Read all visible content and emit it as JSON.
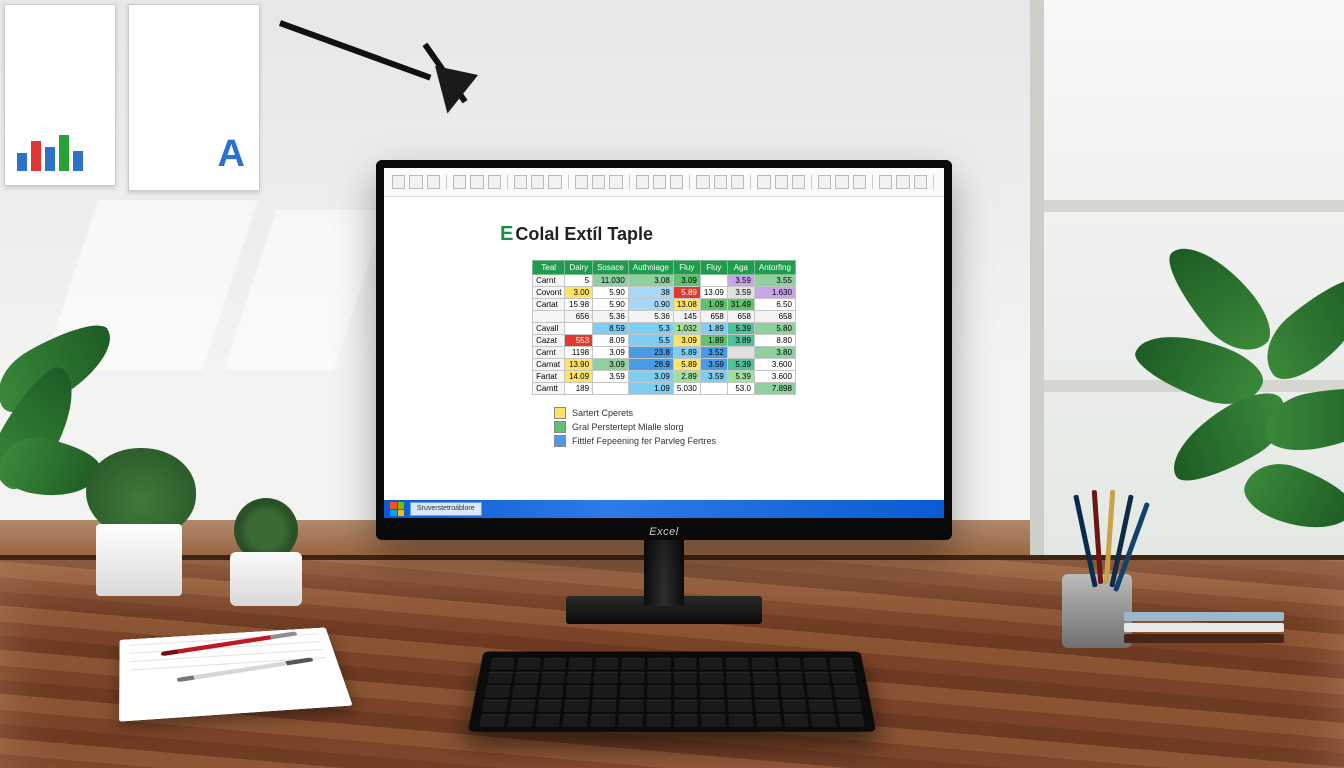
{
  "monitor_brand": "Excel",
  "screen": {
    "title_prefix": "E",
    "title_rest": "Colal Extíl Taple",
    "toolbar_groups": 9,
    "table": {
      "headers": [
        "Teal",
        "Dairy",
        "Sosace",
        "Authniage",
        "Fluy",
        "Fluy",
        "Aga",
        "Antorfing"
      ],
      "rows": [
        {
          "label": "Carnt",
          "cells": [
            {
              "v": "5",
              "bg": "#ffffff"
            },
            {
              "v": "11.030",
              "bg": "#8fd19e"
            },
            {
              "v": "3.08",
              "bg": "#8fd19e"
            },
            {
              "v": "3.09",
              "bg": "#5ec26e"
            },
            {
              "v": "",
              "bg": "#ffffff"
            },
            {
              "v": "3.59",
              "bg": "#c7a6e8"
            },
            {
              "v": "3.55",
              "bg": "#8fd19e"
            }
          ]
        },
        {
          "label": "Covont",
          "cells": [
            {
              "v": "3.00",
              "bg": "#ffe367"
            },
            {
              "v": "5.90",
              "bg": "#ffffff"
            },
            {
              "v": "38",
              "bg": "#a9d7f7"
            },
            {
              "v": "5.89",
              "bg": "#e23b2e"
            },
            {
              "v": "13.09",
              "bg": "#ffffff"
            },
            {
              "v": "3.59",
              "bg": "#e0e0e0"
            },
            {
              "v": "1.630",
              "bg": "#c7a6e8"
            }
          ]
        },
        {
          "label": "Cartat",
          "cells": [
            {
              "v": "15.98",
              "bg": "#ffffff"
            },
            {
              "v": "5.90",
              "bg": "#ffffff"
            },
            {
              "v": "0.90",
              "bg": "#a9d7f7"
            },
            {
              "v": "13.08",
              "bg": "#ffe367"
            },
            {
              "v": "1.09",
              "bg": "#5ec26e"
            },
            {
              "v": "31.49",
              "bg": "#5ec26e"
            },
            {
              "v": "6.50",
              "bg": "#ffffff"
            }
          ]
        },
        {
          "label": "",
          "cells": [
            {
              "v": "656",
              "bg": "#f4f4f4"
            },
            {
              "v": "5.36",
              "bg": "#f4f4f4"
            },
            {
              "v": "5.36",
              "bg": "#f4f4f4"
            },
            {
              "v": "145",
              "bg": "#f4f4f4"
            },
            {
              "v": "658",
              "bg": "#f4f4f4"
            },
            {
              "v": "658",
              "bg": "#f4f4f4"
            },
            {
              "v": "658",
              "bg": "#f4f4f4"
            }
          ]
        },
        {
          "label": "Cavall",
          "cells": [
            {
              "v": "",
              "bg": "#ffffff"
            },
            {
              "v": "8.59",
              "bg": "#7ecdf2"
            },
            {
              "v": "5.3",
              "bg": "#7ecdf2"
            },
            {
              "v": "1.032",
              "bg": "#a3e0a0"
            },
            {
              "v": "1.89",
              "bg": "#7ecdf2"
            },
            {
              "v": "5.39",
              "bg": "#50c29a"
            },
            {
              "v": "5.80",
              "bg": "#8fd19e"
            }
          ]
        },
        {
          "label": "Cazat",
          "cells": [
            {
              "v": "553",
              "bg": "#e23b2e"
            },
            {
              "v": "8.09",
              "bg": "#ffffff"
            },
            {
              "v": "5.5",
              "bg": "#7ecdf2"
            },
            {
              "v": "3.09",
              "bg": "#ffe367"
            },
            {
              "v": "1.89",
              "bg": "#5ec26e"
            },
            {
              "v": "3.89",
              "bg": "#50c29a"
            },
            {
              "v": "8.80",
              "bg": "#ffffff"
            }
          ]
        },
        {
          "label": "Carnt",
          "cells": [
            {
              "v": "1198",
              "bg": "#ffffff"
            },
            {
              "v": "3.09",
              "bg": "#ffffff"
            },
            {
              "v": "23.8",
              "bg": "#4a9be6"
            },
            {
              "v": "5.89",
              "bg": "#7ecdf2"
            },
            {
              "v": "3.52",
              "bg": "#4a9be6"
            },
            {
              "v": "",
              "bg": "#e0e0e0"
            },
            {
              "v": "3.80",
              "bg": "#8fd19e"
            }
          ]
        },
        {
          "label": "Carnat",
          "cells": [
            {
              "v": "13.90",
              "bg": "#ffe367"
            },
            {
              "v": "3.09",
              "bg": "#8fd19e"
            },
            {
              "v": "28.9",
              "bg": "#4a9be6"
            },
            {
              "v": "5.89",
              "bg": "#ffe367"
            },
            {
              "v": "3.59",
              "bg": "#4a9be6"
            },
            {
              "v": "5.39",
              "bg": "#50c29a"
            },
            {
              "v": "3.600",
              "bg": "#ffffff"
            }
          ]
        },
        {
          "label": "Fartat",
          "cells": [
            {
              "v": "14.09",
              "bg": "#ffe367"
            },
            {
              "v": "3.59",
              "bg": "#ffffff"
            },
            {
              "v": "3.09",
              "bg": "#7ecdf2"
            },
            {
              "v": "2.89",
              "bg": "#a3e0a0"
            },
            {
              "v": "3.59",
              "bg": "#7ecdf2"
            },
            {
              "v": "5.39",
              "bg": "#a3e0a0"
            },
            {
              "v": "3.600",
              "bg": "#ffffff"
            }
          ]
        },
        {
          "label": "Carntt",
          "cells": [
            {
              "v": "189",
              "bg": "#ffffff"
            },
            {
              "v": "",
              "bg": "#ffffff"
            },
            {
              "v": "1.09",
              "bg": "#7ecdf2"
            },
            {
              "v": "5.030",
              "bg": "#ffffff"
            },
            {
              "v": "",
              "bg": "#ffffff"
            },
            {
              "v": "53.0",
              "bg": "#ffffff"
            },
            {
              "v": "7.898",
              "bg": "#8fd19e"
            }
          ]
        }
      ]
    },
    "legend": [
      {
        "color": "#ffe367",
        "label": "Sartert Cperets"
      },
      {
        "color": "#5ec26e",
        "label": "Gral Perstertept Mlalle slorg"
      },
      {
        "color": "#4a9be6",
        "label": "Fittlef Fepeening fer Parvleg Fertres"
      }
    ],
    "taskbar_item": "Sruverstetroáblore"
  },
  "poster_letter": "A"
}
